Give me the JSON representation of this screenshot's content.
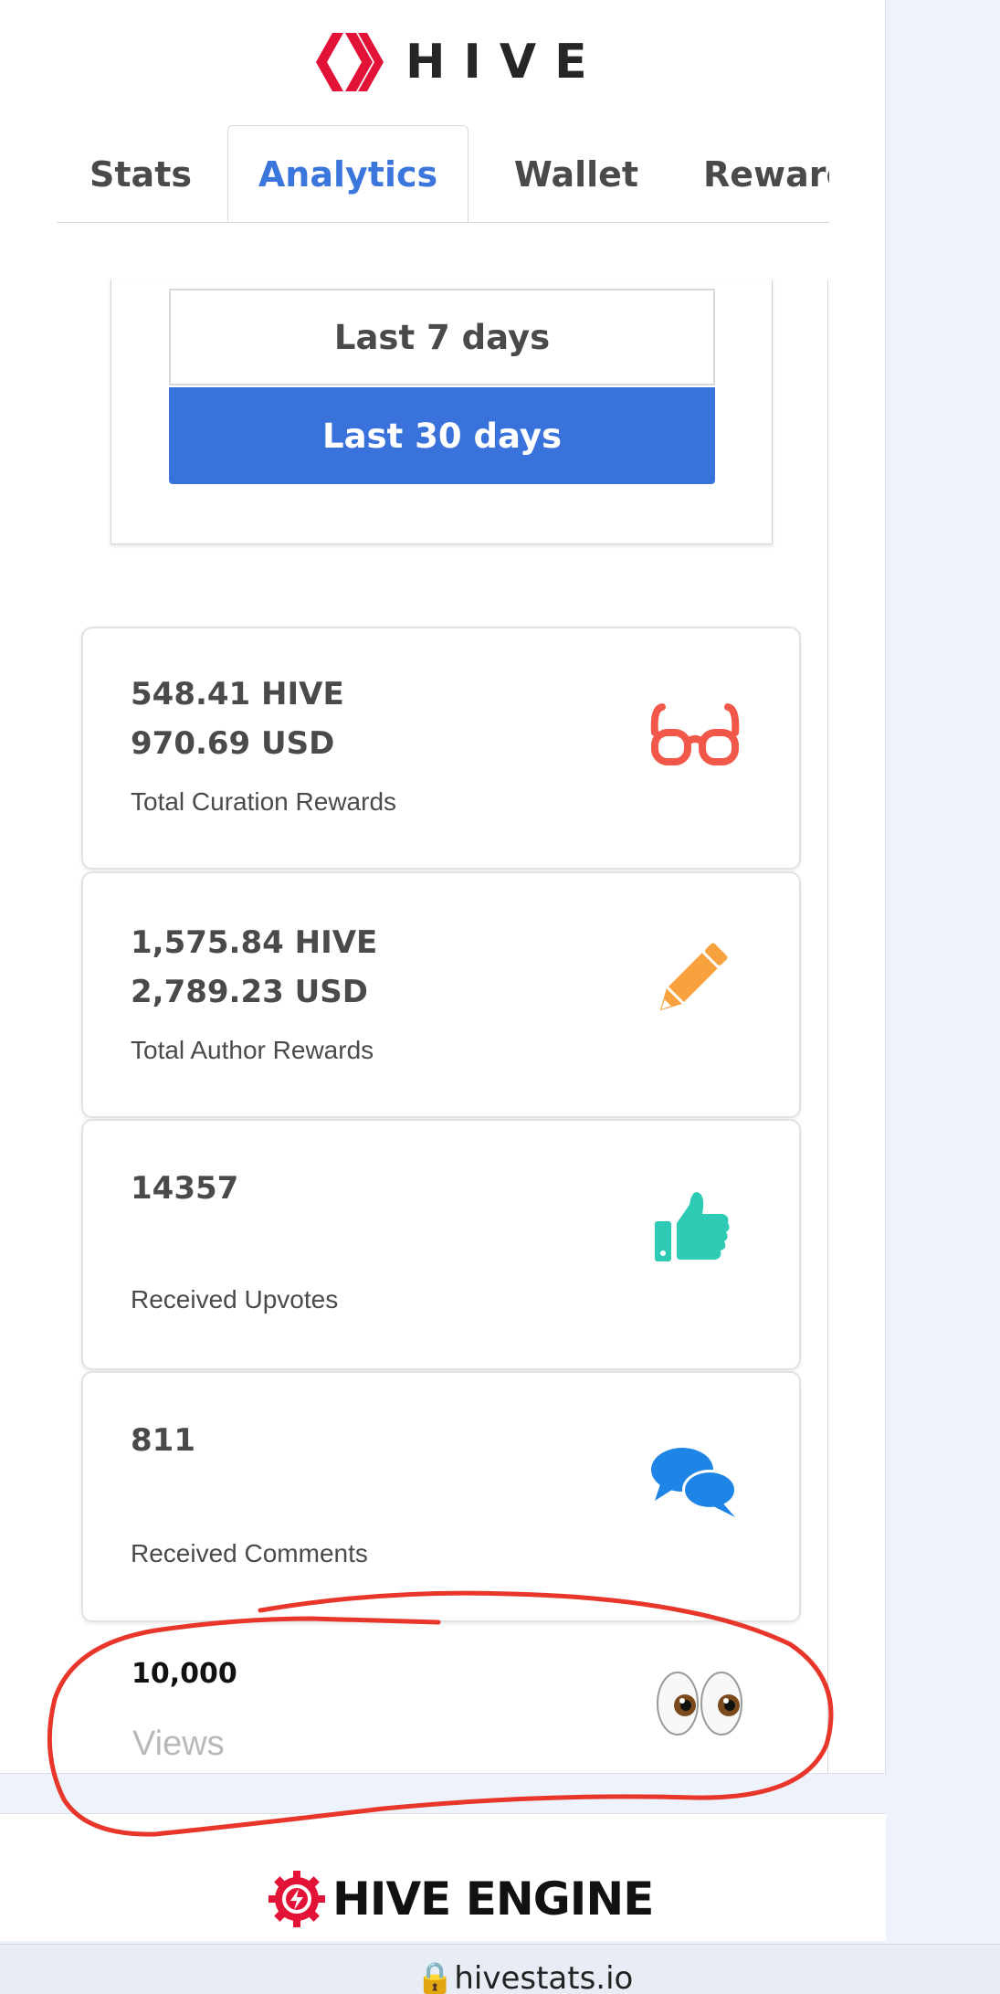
{
  "brand": {
    "name": "HIVE",
    "accent": "#e31337"
  },
  "tabs": [
    {
      "label": "Stats"
    },
    {
      "label": "Analytics",
      "active": true
    },
    {
      "label": "Wallet"
    },
    {
      "label": "Rewarc"
    }
  ],
  "range": {
    "options": [
      "Last 7 days",
      "Last 30 days"
    ],
    "selected": "Last 30 days",
    "selected_color": "#3a72dc"
  },
  "cards": [
    {
      "line1": "548.41 HIVE",
      "line2": "970.69 USD",
      "label": "Total Curation Rewards",
      "icon": "glasses-icon",
      "icon_color": "#f2584a"
    },
    {
      "line1": "1,575.84 HIVE",
      "line2": "2,789.23 USD",
      "label": "Total Author Rewards",
      "icon": "pencil-icon",
      "icon_color": "#f7a23f"
    },
    {
      "line1": "14357",
      "line2": "",
      "label": "Received Upvotes",
      "icon": "thumbs-up-icon",
      "icon_color": "#2dcab4"
    },
    {
      "line1": "811",
      "line2": "",
      "label": "Received Comments",
      "icon": "comments-icon",
      "icon_color": "#1e84e6"
    }
  ],
  "views": {
    "value": "10,000",
    "label": "Views",
    "icon": "eyes-icon"
  },
  "footer_brand": {
    "name": "HIVE ENGINE"
  },
  "browser": {
    "url": "hivestats.io"
  },
  "annotation_color": "#e8362a"
}
